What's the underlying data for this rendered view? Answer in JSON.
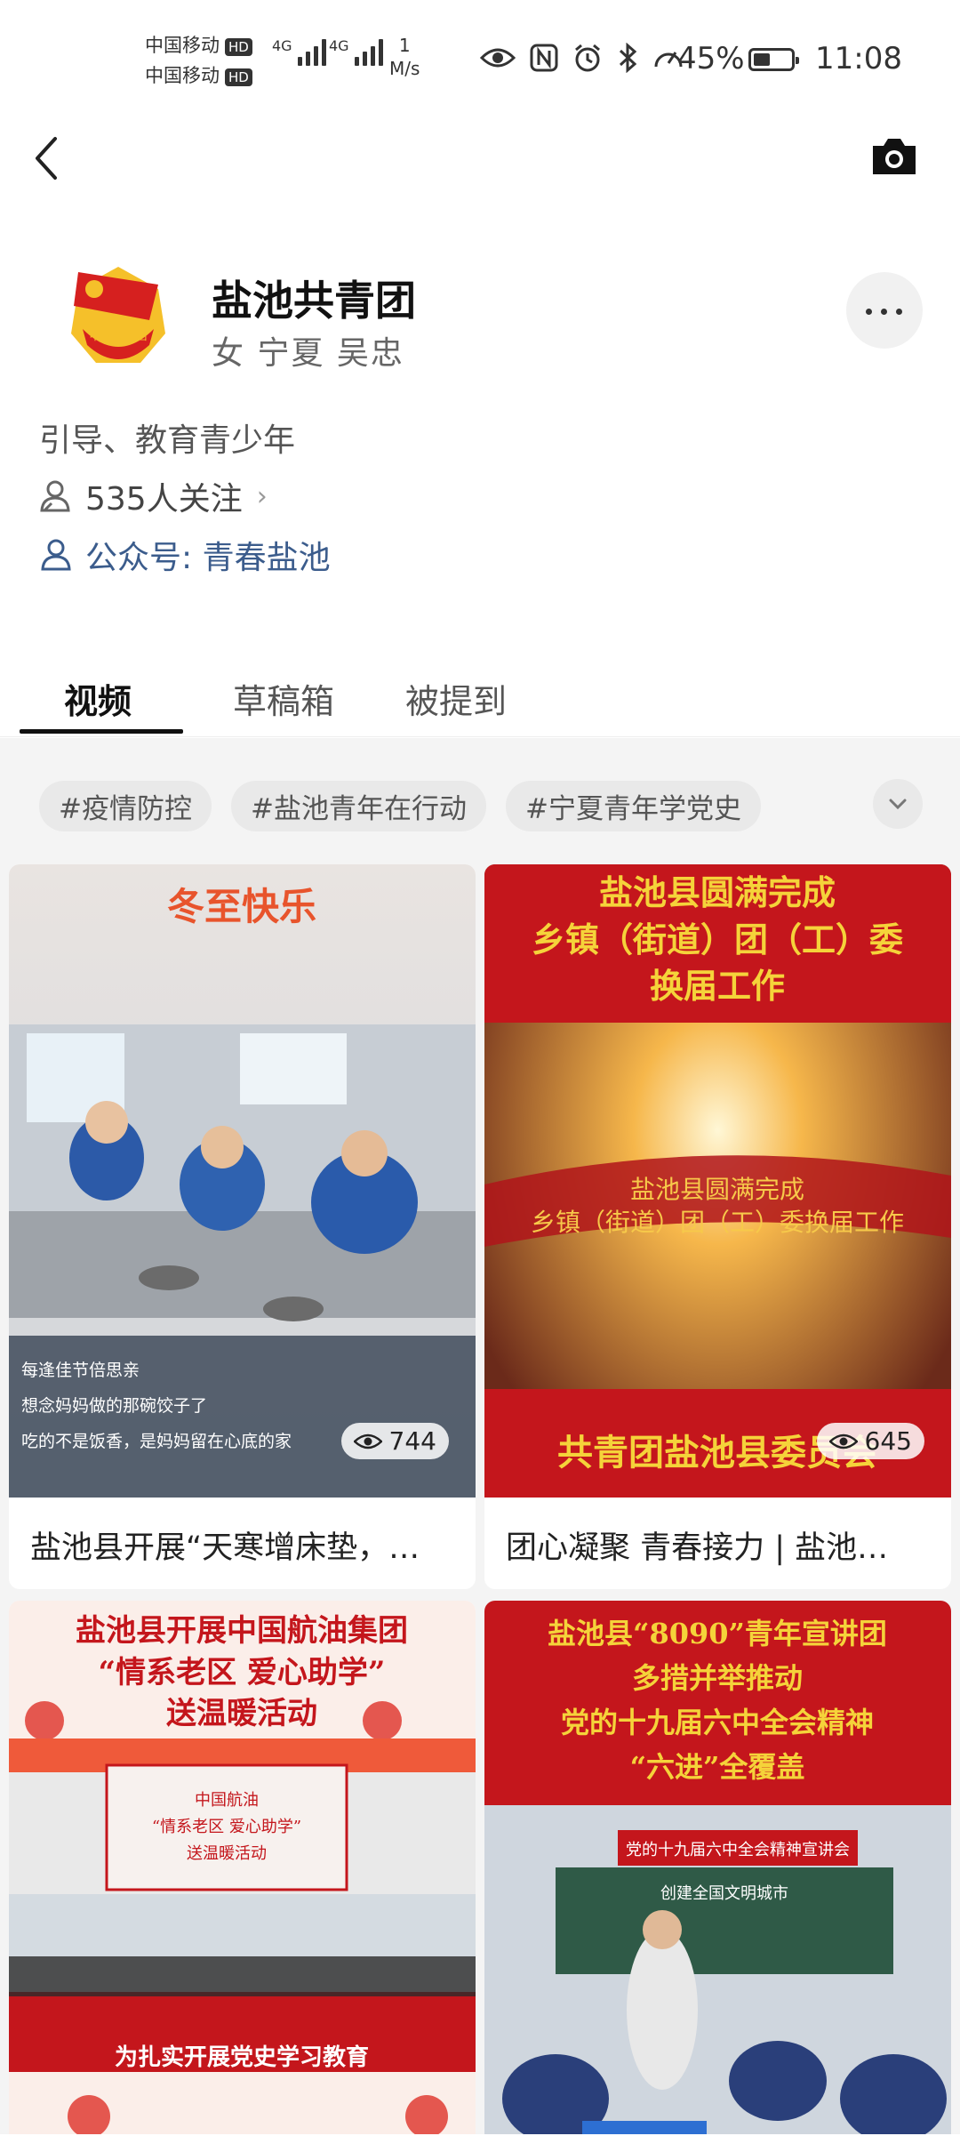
{
  "status_bar": {
    "carrier1": "中国移动",
    "carrier2": "中国移动",
    "hd": "HD",
    "net1": "4G",
    "net2": "4G",
    "speed_value": "1",
    "speed_unit": "M/s",
    "battery": "45%",
    "time": "11:08",
    "icons": [
      "eye-icon",
      "nfc-icon",
      "alarm-icon",
      "bluetooth-icon",
      "speedometer-icon"
    ]
  },
  "profile": {
    "name": "盐池共青团",
    "meta": "女 宁夏 吴忠",
    "bio": "引导、教育青少年",
    "followers": "535人关注",
    "official_account": "公众号: 青春盐池",
    "avatar_text": "中国共青团"
  },
  "tabs": [
    {
      "label": "视频"
    },
    {
      "label": "草稿箱"
    },
    {
      "label": "被提到"
    }
  ],
  "tags": [
    "#疫情防控",
    "#盐池青年在行动",
    "#宁夏青年学党史"
  ],
  "videos": [
    {
      "caption": "盐池县开展“天寒增床垫，…",
      "views": "744",
      "overlay_title": "冬至快乐",
      "overlay_lines": [
        "每逢佳节倍思亲",
        "想念妈妈做的那碗饺子了",
        "吃的不是饭香，是妈妈留在心底的家"
      ]
    },
    {
      "caption": "团心凝聚 青春接力 | 盐池…",
      "views": "645",
      "overlay_title_lines": [
        "盐池县圆满完成",
        "乡镇（街道）团（工）委",
        "换届工作"
      ],
      "ribbon_lines": [
        "盐池县圆满完成",
        "乡镇（街道）团（工）委换届工作"
      ],
      "bottom_title": "共青团盐池县委员会"
    },
    {
      "overlay_title_lines": [
        "盐池县开展中国航油集团",
        "“情系老区 爱心助学”",
        "送温暖活动"
      ],
      "screen_lines": [
        "中国航油",
        "“情系老区 爱心助学”",
        "送温暖活动"
      ],
      "subtitle": "为扎实开展党史学习教育"
    },
    {
      "overlay_title_lines": [
        "盐池县“8090”青年宣讲团",
        "多措并举推动",
        "党的十九届六中全会精神",
        "“六进”全覆盖"
      ],
      "banner": "党的十九届六中全会精神宣讲会",
      "board": "创建全国文明城市"
    }
  ],
  "colors": {
    "accent_red": "#c4161c",
    "gold": "#f5d33a",
    "link_blue": "#3b5c8c"
  }
}
